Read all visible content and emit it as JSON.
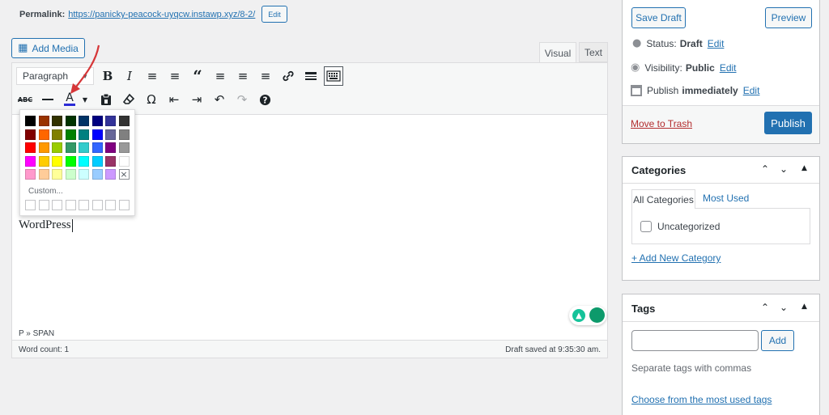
{
  "permalink": {
    "label": "Permalink:",
    "url": "https://panicky-peacock-uyqcw.instawp.xyz/8-2/",
    "edit": "Edit"
  },
  "add_media": "Add Media",
  "tabs": {
    "visual": "Visual",
    "text": "Text"
  },
  "toolbar": {
    "format_select": "Paragraph"
  },
  "color_picker": {
    "custom_label": "Custom...",
    "rows": [
      [
        "#000000",
        "#993300",
        "#333300",
        "#003300",
        "#003366",
        "#000080",
        "#333399",
        "#333333"
      ],
      [
        "#800000",
        "#ff6600",
        "#808000",
        "#008000",
        "#008080",
        "#0000ff",
        "#666699",
        "#808080"
      ],
      [
        "#ff0000",
        "#ff9900",
        "#99cc00",
        "#339966",
        "#33cccc",
        "#3366ff",
        "#800080",
        "#999999"
      ],
      [
        "#ff00ff",
        "#ffcc00",
        "#ffff00",
        "#00ff00",
        "#00ffff",
        "#00ccff",
        "#993366",
        "#ffffff"
      ],
      [
        "#ff99cc",
        "#ffcc99",
        "#ffff99",
        "#ccffcc",
        "#ccffff",
        "#99ccff",
        "#cc99ff",
        "none"
      ]
    ]
  },
  "editor": {
    "content": "WordPress",
    "path": "P » SPAN"
  },
  "status_bar": {
    "word_count": "Word count: 1",
    "draft_saved": "Draft saved at 9:35:30 am."
  },
  "publish": {
    "save_draft": "Save Draft",
    "preview": "Preview",
    "status_label": "Status:",
    "status_value": "Draft",
    "visibility_label": "Visibility:",
    "visibility_value": "Public",
    "publish_label": "Publish",
    "publish_value": "immediately",
    "edit": "Edit",
    "trash": "Move to Trash",
    "publish_button": "Publish"
  },
  "categories": {
    "title": "Categories",
    "tab_all": "All Categories",
    "tab_used": "Most Used",
    "items": [
      "Uncategorized"
    ],
    "add_new": "+ Add New Category"
  },
  "tags": {
    "title": "Tags",
    "add": "Add",
    "hint": "Separate tags with commas",
    "choose": "Choose from the most used tags"
  },
  "colors": {
    "accent": "#2271b1",
    "arrow": "#d63638"
  }
}
